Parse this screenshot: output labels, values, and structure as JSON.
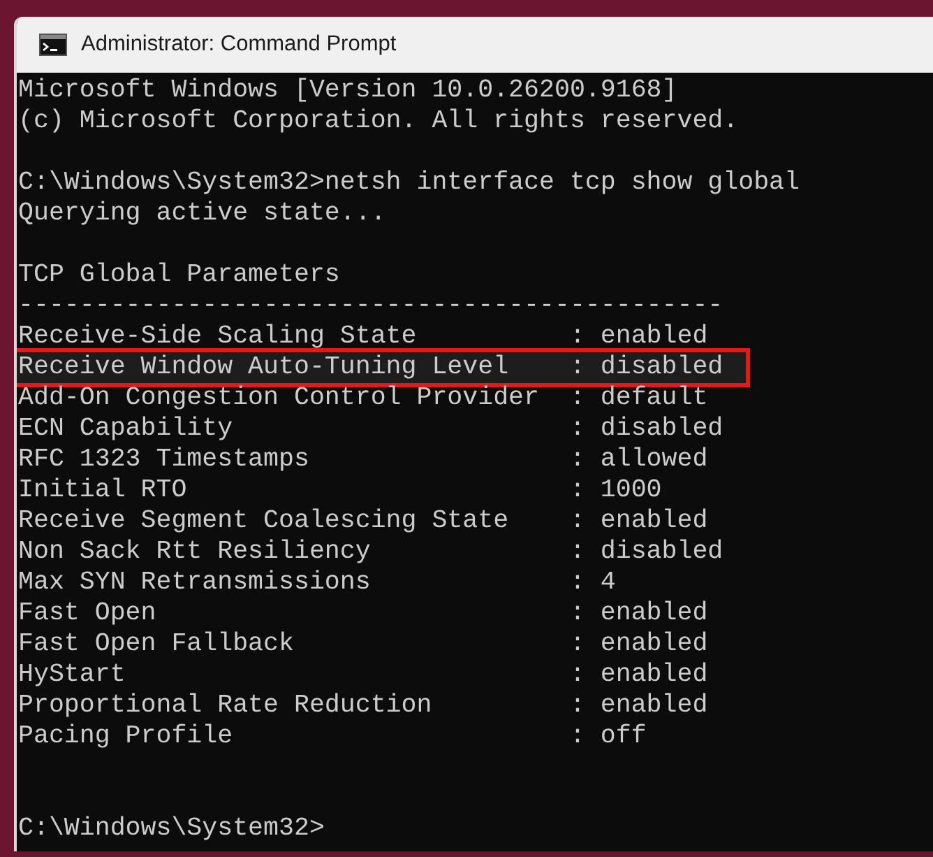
{
  "window": {
    "title": "Administrator: Command Prompt"
  },
  "console": {
    "banner": [
      "Microsoft Windows [Version 10.0.26200.9168]",
      "(c) Microsoft Corporation. All rights reserved."
    ],
    "command": "C:\\Windows\\System32>netsh interface tcp show global",
    "status": "Querying active state...",
    "heading": "TCP Global Parameters",
    "rule": "----------------------------------------------",
    "params": [
      {
        "text": "Receive-Side Scaling State          : enabled",
        "highlighted": false
      },
      {
        "text": "Receive Window Auto-Tuning Level    : disabled",
        "highlighted": true
      },
      {
        "text": "Add-On Congestion Control Provider  : default",
        "highlighted": false
      },
      {
        "text": "ECN Capability                      : disabled",
        "highlighted": false
      },
      {
        "text": "RFC 1323 Timestamps                 : allowed",
        "highlighted": false
      },
      {
        "text": "Initial RTO                         : 1000",
        "highlighted": false
      },
      {
        "text": "Receive Segment Coalescing State    : enabled",
        "highlighted": false
      },
      {
        "text": "Non Sack Rtt Resiliency             : disabled",
        "highlighted": false
      },
      {
        "text": "Max SYN Retransmissions             : 4",
        "highlighted": false
      },
      {
        "text": "Fast Open                           : enabled",
        "highlighted": false
      },
      {
        "text": "Fast Open Fallback                  : enabled",
        "highlighted": false
      },
      {
        "text": "HyStart                             : enabled",
        "highlighted": false
      },
      {
        "text": "Proportional Rate Reduction         : enabled",
        "highlighted": false
      },
      {
        "text": "Pacing Profile                      : off",
        "highlighted": false
      }
    ],
    "prompt": "C:\\Windows\\System32>"
  }
}
